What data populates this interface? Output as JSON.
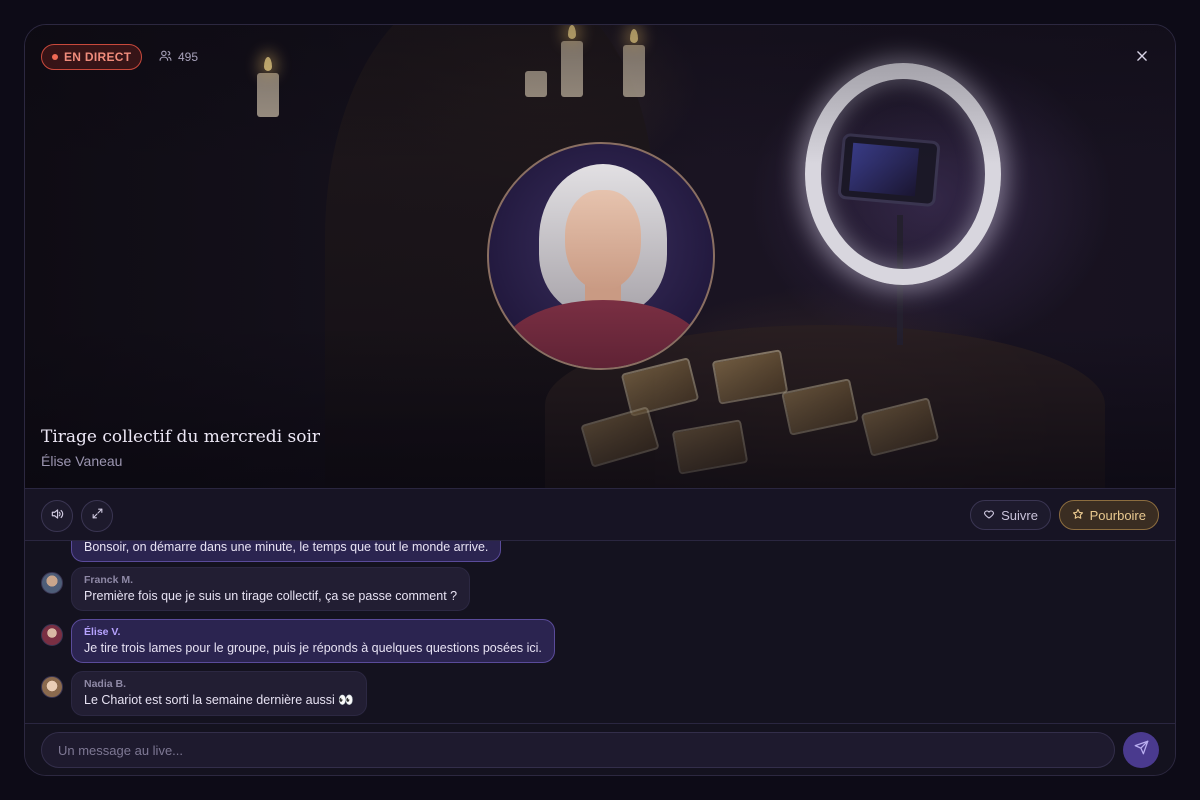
{
  "stream": {
    "live_label": "EN DIRECT",
    "viewer_count": "495",
    "title": "Tirage collectif du mercredi soir",
    "host": "Élise Vaneau"
  },
  "controls": {
    "follow_label": "Suivre",
    "tip_label": "Pourboire"
  },
  "chat": {
    "messages": [
      {
        "author": "",
        "text": "Bonsoir, on démarre dans une minute, le temps que tout le monde arrive.",
        "is_host": true
      },
      {
        "author": "Franck M.",
        "text": "Première fois que je suis un tirage collectif, ça se passe comment ?",
        "is_host": false
      },
      {
        "author": "Élise V.",
        "text": "Je tire trois lames pour le groupe, puis je réponds à quelques questions posées ici.",
        "is_host": true
      },
      {
        "author": "Nadia B.",
        "text": "Le Chariot est sorti la semaine dernière aussi 👀",
        "is_host": false
      }
    ]
  },
  "composer": {
    "placeholder": "Un message au live..."
  },
  "icons": {
    "viewers": "users-icon",
    "close": "close-icon",
    "volume": "volume-icon",
    "fullscreen": "expand-icon",
    "follow": "heart-icon",
    "tip": "star-icon",
    "send": "send-icon"
  },
  "colors": {
    "live": "#ef6a55",
    "accent": "#4a3a8e",
    "tip": "#e8c88f",
    "host_name": "#b7a3ff"
  }
}
